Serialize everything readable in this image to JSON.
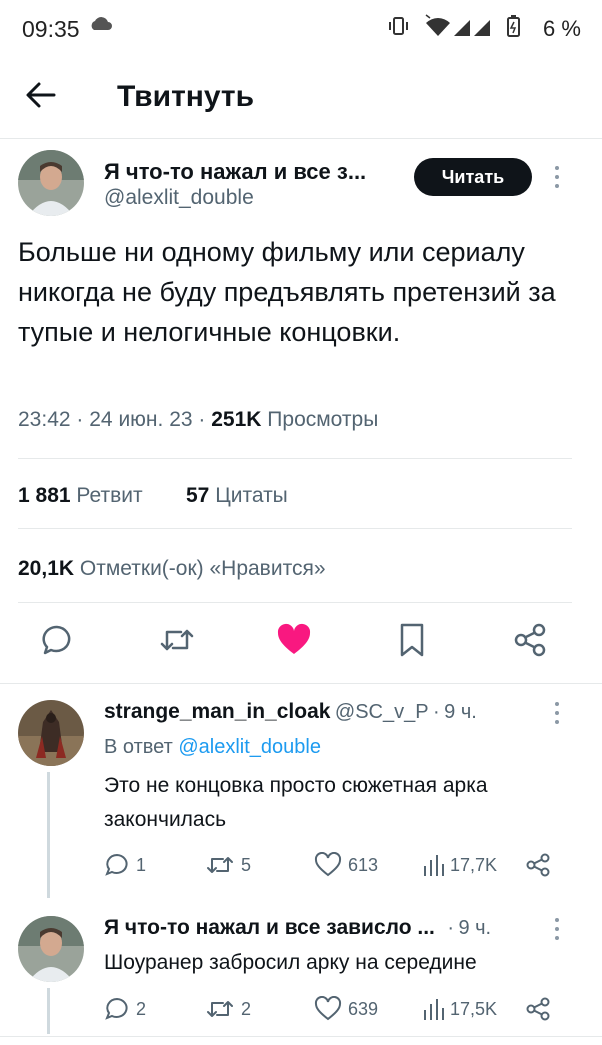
{
  "status_bar": {
    "time": "09:35",
    "battery": "6 %"
  },
  "header": {
    "title": "Твитнуть"
  },
  "tweet": {
    "author_name": "Я что-то нажал и все з...",
    "author_handle": "@alexlit_double",
    "follow_label": "Читать",
    "text": "Больше ни одному фильму или сериалу никогда не буду предъявлять претензий за тупые и нелогичные концовки.",
    "time": "23:42",
    "sep1": "·",
    "date": "24 июн. 23",
    "sep2": "·",
    "views_count": "251K",
    "views_label": "Просмотры",
    "retweets_count": "1 881",
    "retweets_label": "Ретвит",
    "quotes_count": "57",
    "quotes_label": "Цитаты",
    "likes_count": "20,1K",
    "likes_label": "Отметки(-ок) «Нравится»",
    "like_color": "#f91880"
  },
  "replies": [
    {
      "name": "strange_man_in_cloak",
      "handle": "@SC_v_P",
      "dot": "·",
      "time": "9 ч.",
      "reply_to_prefix": "В ответ",
      "reply_to_handle": "@alexlit_double",
      "text": "Это не концовка просто сюжетная арка закончилась",
      "replies": "1",
      "retweets": "5",
      "likes": "613",
      "views": "17,7K"
    },
    {
      "name": "Я что-то нажал и все зависло ...",
      "dot": "·",
      "time": "9 ч.",
      "text": "Шоуранер забросил арку на середине",
      "replies": "2",
      "retweets": "2",
      "likes": "639",
      "views": "17,5K"
    }
  ]
}
